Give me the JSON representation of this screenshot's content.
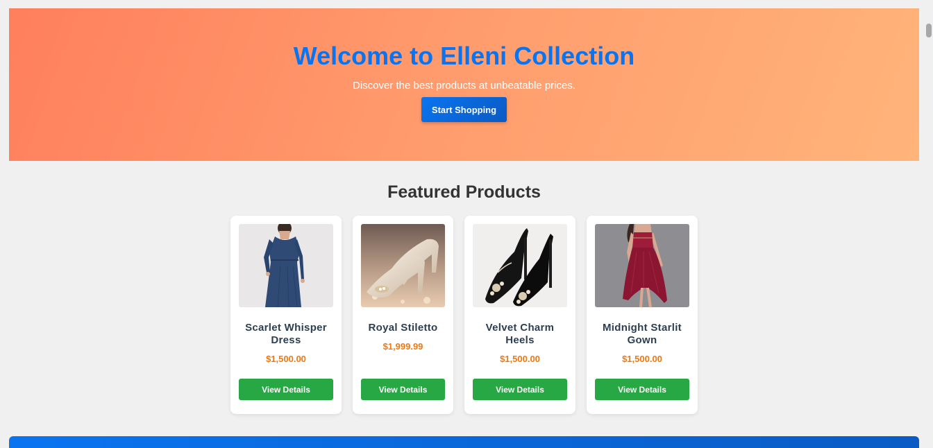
{
  "hero": {
    "title": "Welcome to Elleni Collection",
    "subtitle": "Discover the best products at unbeatable prices.",
    "cta_label": "Start Shopping"
  },
  "featured": {
    "title": "Featured Products",
    "products": [
      {
        "name": "Scarlet Whisper Dress",
        "price": "$1,500.00",
        "button_label": "View Details",
        "image": "navy-wrap-dress-photo"
      },
      {
        "name": "Royal Stiletto",
        "price": "$1,999.99",
        "button_label": "View Details",
        "image": "champagne-stiletto-photo"
      },
      {
        "name": "Velvet Charm Heels",
        "price": "$1,500.00",
        "button_label": "View Details",
        "image": "black-jeweled-heels-photo"
      },
      {
        "name": "Midnight Starlit Gown",
        "price": "$1,500.00",
        "button_label": "View Details",
        "image": "burgundy-lace-gown-photo"
      }
    ]
  },
  "colors": {
    "hero_gradient_start": "#ff7f5c",
    "hero_gradient_end": "#ffb47a",
    "title_blue": "#0a74f0",
    "price_orange": "#f07810",
    "button_green": "#28a745"
  }
}
